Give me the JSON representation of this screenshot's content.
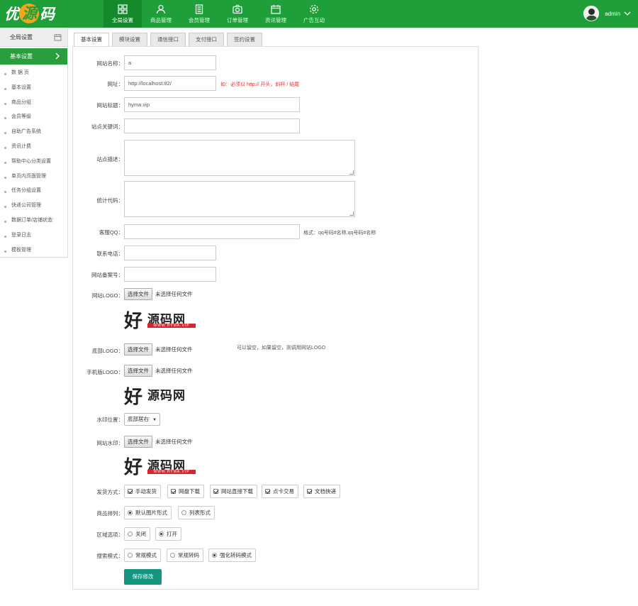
{
  "app": {
    "logo_text_left": "优",
    "logo_text_mid": "源",
    "logo_text_right": "码"
  },
  "nav": [
    {
      "label": "全局设置",
      "icon": "grid-icon",
      "active": true
    },
    {
      "label": "商品管理",
      "icon": "user-icon"
    },
    {
      "label": "会员管理",
      "icon": "document-icon"
    },
    {
      "label": "订单管理",
      "icon": "camera-icon"
    },
    {
      "label": "资讯管理",
      "icon": "calendar-icon"
    },
    {
      "label": "广告互动",
      "icon": "gear-icon"
    }
  ],
  "user": {
    "name": "admin"
  },
  "sidebar": {
    "header": "全局设置",
    "active": "基本设置",
    "items": [
      "数 据 页",
      "基本设置",
      "商品分组",
      "会员等级",
      "自助广告系统",
      "资讯计费",
      "帮助中心分类设置",
      "单页内页面管理",
      "任务分组设置",
      "快递公司管理",
      "数据订单/店铺状态",
      "登录日志",
      "模板管理"
    ]
  },
  "tabs": [
    "基本设置",
    "模块设置",
    "通信接口",
    "支付接口",
    "签约设置"
  ],
  "form": {
    "site_name_label": "网站名称：",
    "site_name_value": "a",
    "url_label": "网址：",
    "url_value": "http://localhost:82/",
    "url_hint": "如：必须以 http:// 开头，斜杆 / 结尾",
    "site_title_label": "网站标题：",
    "site_title_value": "hyma.vip",
    "keywords_label": "站点关键词：",
    "description_label": "站点描述：",
    "stats_label": "统计代码：",
    "qq_label": "客服QQ：",
    "qq_hint": "格式：qq号码#名称,qq号码#名称",
    "phone_label": "联系电话：",
    "icp_label": "网站备案号：",
    "logo_label": "网站LOGO：",
    "file_button": "选择文件",
    "no_file": "未选择任何文件",
    "footer_logo_label": "底部LOGO：",
    "footer_logo_hint": "可以留空，如果留空，则调用网站LOGO",
    "mobile_logo_label": "手机版LOGO：",
    "watermark_pos_label": "水印位置：",
    "watermark_pos_value": "底部居右",
    "watermark_label": "网站水印：",
    "brand_text_big": "好",
    "brand_text": "源码网",
    "brand_sub": "WWW.HYMA.VIP",
    "delivery_label": "发货方式：",
    "delivery_options": [
      {
        "label": "手动发货",
        "checked": true
      },
      {
        "label": "网盘下载",
        "checked": true
      },
      {
        "label": "网站直接下载",
        "checked": true
      },
      {
        "label": "点卡交易",
        "checked": true
      },
      {
        "label": "文档快递",
        "checked": true
      }
    ],
    "goods_layout_label": "商品排列：",
    "goods_layout_options": [
      {
        "label": "默认图片形式",
        "checked": true
      },
      {
        "label": "列表形式",
        "checked": false
      }
    ],
    "region_label": "区域选项：",
    "region_options": [
      {
        "label": "关闭",
        "checked": false
      },
      {
        "label": "打开",
        "checked": true
      }
    ],
    "search_label": "搜索模式：",
    "search_options": [
      {
        "label": "常规模式",
        "checked": false
      },
      {
        "label": "常规转码",
        "checked": false
      },
      {
        "label": "强化转码模式",
        "checked": true
      }
    ],
    "save_button": "保存修改"
  },
  "colors": {
    "brand_green": "#1f9f3a",
    "save_teal": "#15957e",
    "hint_red": "#dd3333"
  }
}
